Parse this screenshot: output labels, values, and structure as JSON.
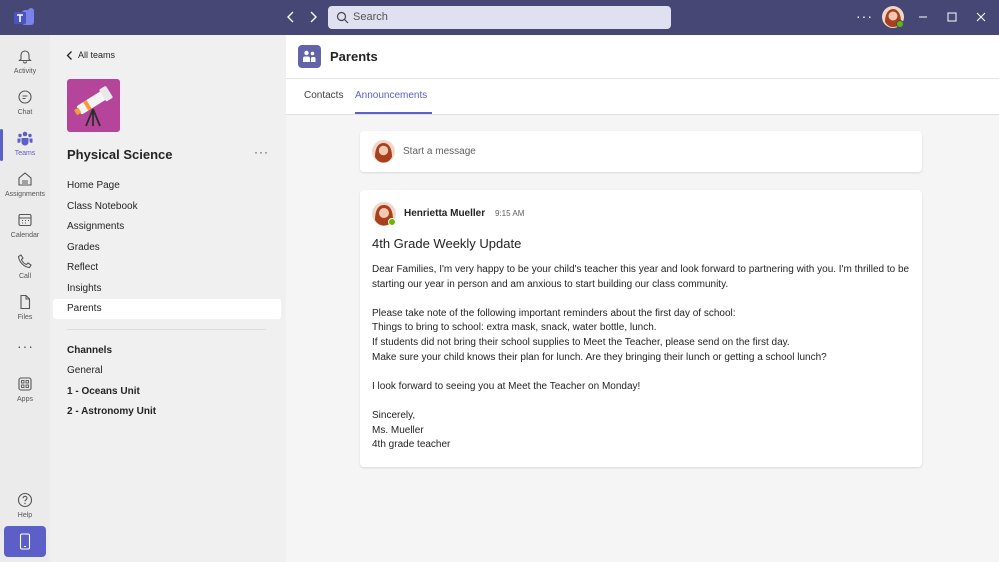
{
  "titlebar": {
    "search_placeholder": "Search",
    "more_label": "···"
  },
  "rail": {
    "items": [
      {
        "label": "Activity",
        "icon": "bell-icon"
      },
      {
        "label": "Chat",
        "icon": "chat-icon"
      },
      {
        "label": "Teams",
        "icon": "teams-icon"
      },
      {
        "label": "Assignments",
        "icon": "assignments-icon"
      },
      {
        "label": "Calendar",
        "icon": "calendar-icon"
      },
      {
        "label": "Call",
        "icon": "phone-icon"
      },
      {
        "label": "Files",
        "icon": "file-icon"
      },
      {
        "label": "Apps",
        "icon": "apps-icon"
      },
      {
        "label": "Help",
        "icon": "help-icon"
      }
    ],
    "more_label": "···",
    "active_color": "#5b5fc7"
  },
  "sidebar": {
    "back_label": "All teams",
    "team_name": "Physical Science",
    "team_more": "···",
    "team_tile_color": "#b4459b",
    "nav": [
      "Home Page",
      "Class Notebook",
      "Assignments",
      "Grades",
      "Reflect",
      "Insights",
      "Parents"
    ],
    "selected_nav": "Parents",
    "channels_heading": "Channels",
    "channels": [
      "General",
      "1 - Oceans Unit",
      "2 - Astronomy Unit"
    ]
  },
  "header": {
    "title": "Parents",
    "tabs": [
      "Contacts",
      "Announcements"
    ],
    "active_tab": "Announcements"
  },
  "compose": {
    "placeholder": "Start a message"
  },
  "post": {
    "author": "Henrietta Mueller",
    "time": "9:15 AM",
    "subject": "4th Grade Weekly Update",
    "body": [
      "Dear Families, I'm very happy to be your child's teacher this year and look forward to partnering with you. I'm thrilled to be starting our year in person and am anxious to start building our class community.",
      "",
      "Please take note of the following important reminders about the first day of school:",
      "Things to bring to school: extra mask, snack, water bottle, lunch.",
      "If students did not bring their school supplies to Meet the Teacher, please send on the first day.",
      "Make sure your child knows their plan for lunch. Are they bringing their lunch or getting a school lunch?",
      "",
      "I look forward to seeing you at Meet the Teacher on Monday!",
      "",
      "Sincerely,",
      "Ms. Mueller",
      "4th grade teacher"
    ]
  }
}
